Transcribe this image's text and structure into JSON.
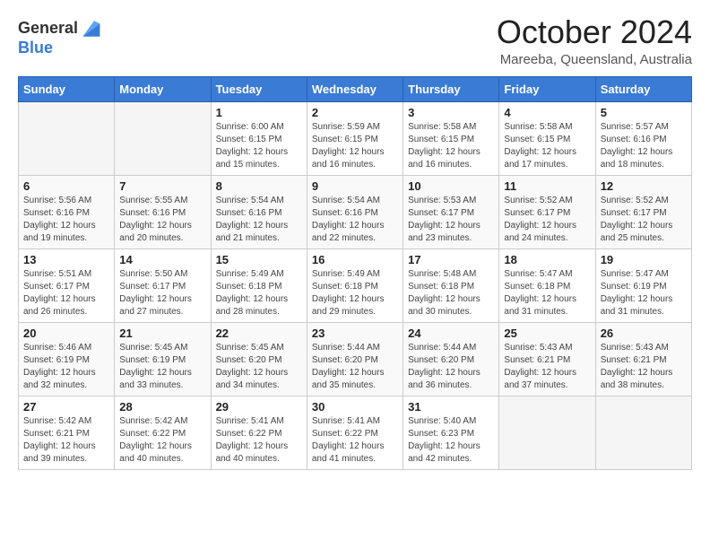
{
  "logo": {
    "general": "General",
    "blue": "Blue"
  },
  "header": {
    "month": "October 2024",
    "location": "Mareeba, Queensland, Australia"
  },
  "days_of_week": [
    "Sunday",
    "Monday",
    "Tuesday",
    "Wednesday",
    "Thursday",
    "Friday",
    "Saturday"
  ],
  "weeks": [
    [
      {
        "day": "",
        "info": ""
      },
      {
        "day": "",
        "info": ""
      },
      {
        "day": "1",
        "info": "Sunrise: 6:00 AM\nSunset: 6:15 PM\nDaylight: 12 hours and 15 minutes."
      },
      {
        "day": "2",
        "info": "Sunrise: 5:59 AM\nSunset: 6:15 PM\nDaylight: 12 hours and 16 minutes."
      },
      {
        "day": "3",
        "info": "Sunrise: 5:58 AM\nSunset: 6:15 PM\nDaylight: 12 hours and 16 minutes."
      },
      {
        "day": "4",
        "info": "Sunrise: 5:58 AM\nSunset: 6:15 PM\nDaylight: 12 hours and 17 minutes."
      },
      {
        "day": "5",
        "info": "Sunrise: 5:57 AM\nSunset: 6:16 PM\nDaylight: 12 hours and 18 minutes."
      }
    ],
    [
      {
        "day": "6",
        "info": "Sunrise: 5:56 AM\nSunset: 6:16 PM\nDaylight: 12 hours and 19 minutes."
      },
      {
        "day": "7",
        "info": "Sunrise: 5:55 AM\nSunset: 6:16 PM\nDaylight: 12 hours and 20 minutes."
      },
      {
        "day": "8",
        "info": "Sunrise: 5:54 AM\nSunset: 6:16 PM\nDaylight: 12 hours and 21 minutes."
      },
      {
        "day": "9",
        "info": "Sunrise: 5:54 AM\nSunset: 6:16 PM\nDaylight: 12 hours and 22 minutes."
      },
      {
        "day": "10",
        "info": "Sunrise: 5:53 AM\nSunset: 6:17 PM\nDaylight: 12 hours and 23 minutes."
      },
      {
        "day": "11",
        "info": "Sunrise: 5:52 AM\nSunset: 6:17 PM\nDaylight: 12 hours and 24 minutes."
      },
      {
        "day": "12",
        "info": "Sunrise: 5:52 AM\nSunset: 6:17 PM\nDaylight: 12 hours and 25 minutes."
      }
    ],
    [
      {
        "day": "13",
        "info": "Sunrise: 5:51 AM\nSunset: 6:17 PM\nDaylight: 12 hours and 26 minutes."
      },
      {
        "day": "14",
        "info": "Sunrise: 5:50 AM\nSunset: 6:17 PM\nDaylight: 12 hours and 27 minutes."
      },
      {
        "day": "15",
        "info": "Sunrise: 5:49 AM\nSunset: 6:18 PM\nDaylight: 12 hours and 28 minutes."
      },
      {
        "day": "16",
        "info": "Sunrise: 5:49 AM\nSunset: 6:18 PM\nDaylight: 12 hours and 29 minutes."
      },
      {
        "day": "17",
        "info": "Sunrise: 5:48 AM\nSunset: 6:18 PM\nDaylight: 12 hours and 30 minutes."
      },
      {
        "day": "18",
        "info": "Sunrise: 5:47 AM\nSunset: 6:18 PM\nDaylight: 12 hours and 31 minutes."
      },
      {
        "day": "19",
        "info": "Sunrise: 5:47 AM\nSunset: 6:19 PM\nDaylight: 12 hours and 31 minutes."
      }
    ],
    [
      {
        "day": "20",
        "info": "Sunrise: 5:46 AM\nSunset: 6:19 PM\nDaylight: 12 hours and 32 minutes."
      },
      {
        "day": "21",
        "info": "Sunrise: 5:45 AM\nSunset: 6:19 PM\nDaylight: 12 hours and 33 minutes."
      },
      {
        "day": "22",
        "info": "Sunrise: 5:45 AM\nSunset: 6:20 PM\nDaylight: 12 hours and 34 minutes."
      },
      {
        "day": "23",
        "info": "Sunrise: 5:44 AM\nSunset: 6:20 PM\nDaylight: 12 hours and 35 minutes."
      },
      {
        "day": "24",
        "info": "Sunrise: 5:44 AM\nSunset: 6:20 PM\nDaylight: 12 hours and 36 minutes."
      },
      {
        "day": "25",
        "info": "Sunrise: 5:43 AM\nSunset: 6:21 PM\nDaylight: 12 hours and 37 minutes."
      },
      {
        "day": "26",
        "info": "Sunrise: 5:43 AM\nSunset: 6:21 PM\nDaylight: 12 hours and 38 minutes."
      }
    ],
    [
      {
        "day": "27",
        "info": "Sunrise: 5:42 AM\nSunset: 6:21 PM\nDaylight: 12 hours and 39 minutes."
      },
      {
        "day": "28",
        "info": "Sunrise: 5:42 AM\nSunset: 6:22 PM\nDaylight: 12 hours and 40 minutes."
      },
      {
        "day": "29",
        "info": "Sunrise: 5:41 AM\nSunset: 6:22 PM\nDaylight: 12 hours and 40 minutes."
      },
      {
        "day": "30",
        "info": "Sunrise: 5:41 AM\nSunset: 6:22 PM\nDaylight: 12 hours and 41 minutes."
      },
      {
        "day": "31",
        "info": "Sunrise: 5:40 AM\nSunset: 6:23 PM\nDaylight: 12 hours and 42 minutes."
      },
      {
        "day": "",
        "info": ""
      },
      {
        "day": "",
        "info": ""
      }
    ]
  ]
}
